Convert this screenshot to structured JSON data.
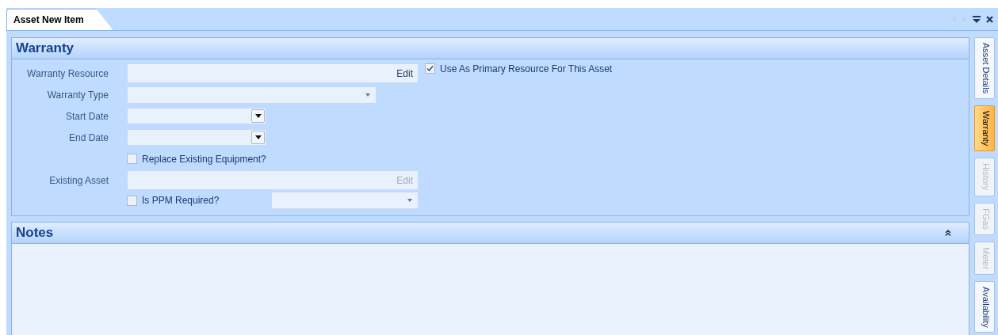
{
  "document_tab": {
    "title": "Asset New Item",
    "selected": true
  },
  "warranty_panel": {
    "title": "Warranty",
    "fields": [
      {
        "kind": "lookup",
        "label": "Warranty Resource",
        "button": "Edit",
        "disabled": false,
        "checkbox": {
          "label": "Use As Primary Resource For This Asset",
          "checked": true
        }
      },
      {
        "kind": "combo",
        "label": "Warranty Type"
      },
      {
        "kind": "date",
        "label": "Start Date"
      },
      {
        "kind": "date",
        "label": "End Date"
      },
      {
        "kind": "check",
        "label": "Replace Existing Equipment?",
        "checked": false
      },
      {
        "kind": "lookup",
        "label": "Existing Asset",
        "button": "Edit",
        "disabled": true
      },
      {
        "kind": "checkcombo",
        "label": "Is PPM Required?",
        "checked": false
      }
    ]
  },
  "notes_panel": {
    "title": "Notes",
    "expanded": true
  },
  "side_tabs": [
    {
      "label": "Asset Details",
      "selected": false,
      "disabled": false
    },
    {
      "label": "Warranty",
      "selected": true,
      "disabled": false
    },
    {
      "label": "History",
      "selected": false,
      "disabled": true
    },
    {
      "label": "FGas",
      "selected": false,
      "disabled": true
    },
    {
      "label": "Meter",
      "selected": false,
      "disabled": true
    },
    {
      "label": "Availability",
      "selected": false,
      "disabled": false
    }
  ]
}
